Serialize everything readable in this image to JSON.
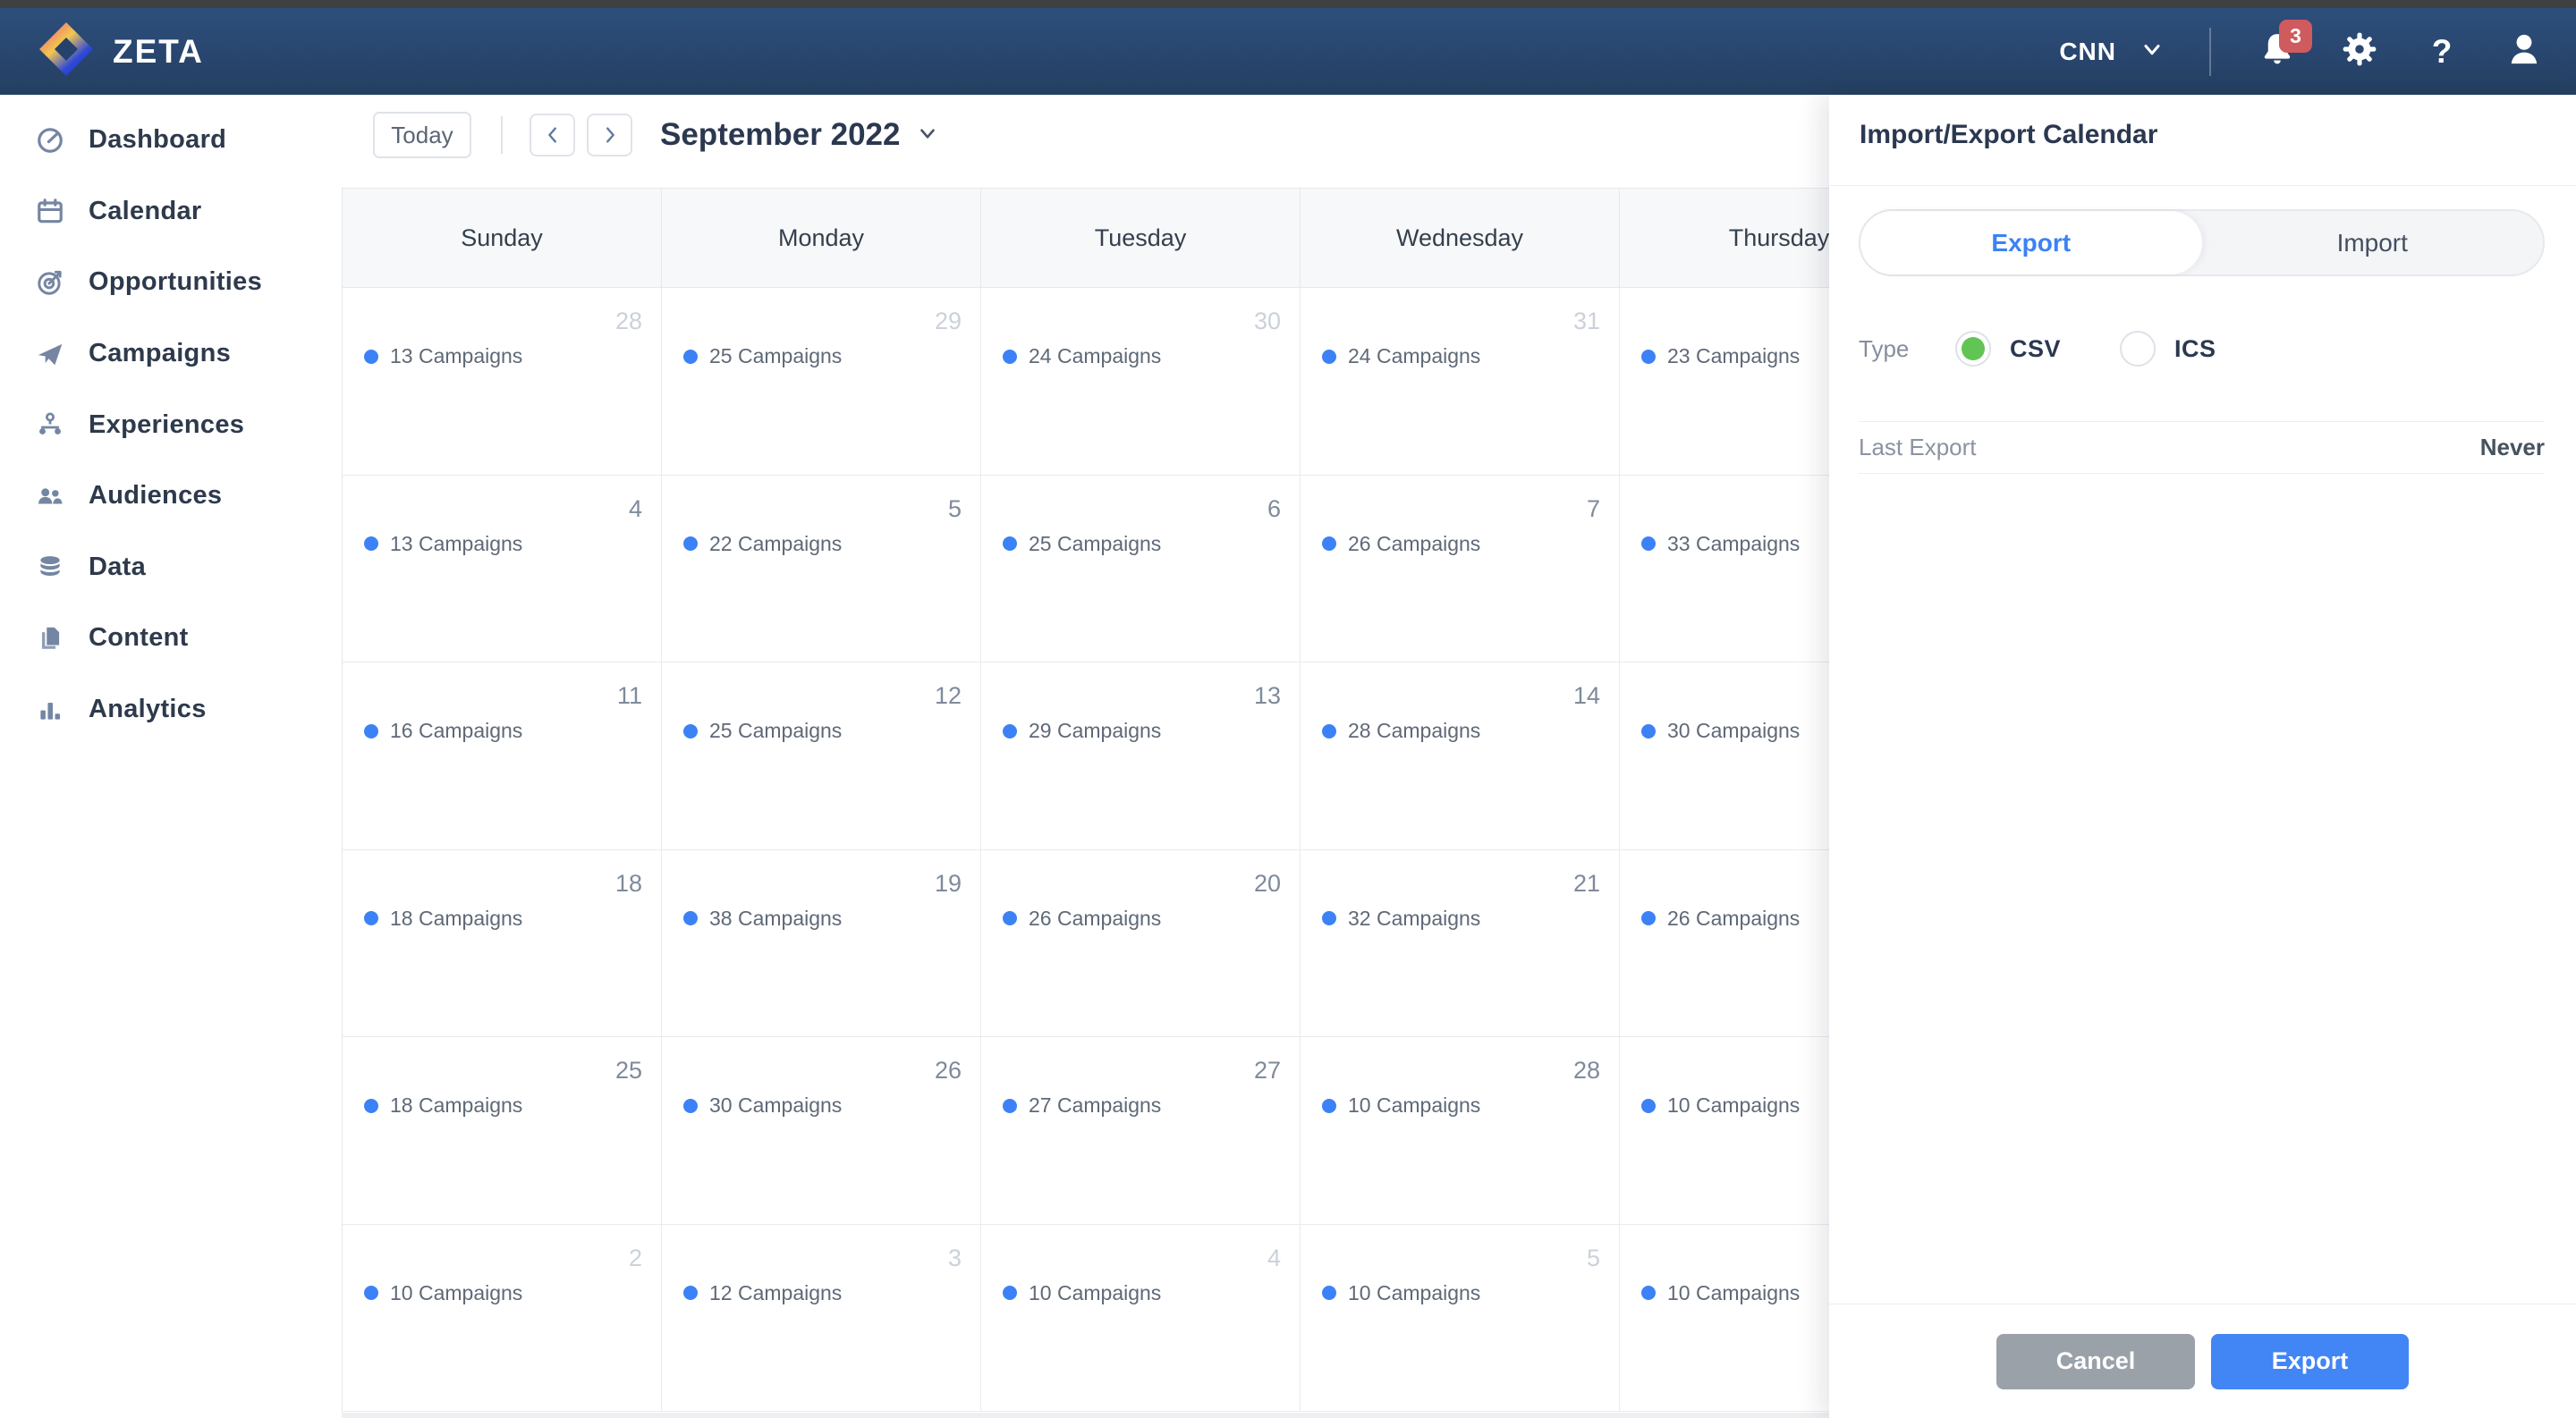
{
  "navbar": {
    "brand": "ZETA",
    "account": "CNN",
    "notification_count": "3",
    "help_glyph": "?"
  },
  "sidebar": {
    "items": [
      {
        "label": "Dashboard",
        "icon": "dashboard-icon"
      },
      {
        "label": "Calendar",
        "icon": "calendar-icon"
      },
      {
        "label": "Opportunities",
        "icon": "opportunities-icon"
      },
      {
        "label": "Campaigns",
        "icon": "campaigns-icon"
      },
      {
        "label": "Experiences",
        "icon": "experiences-icon"
      },
      {
        "label": "Audiences",
        "icon": "audiences-icon"
      },
      {
        "label": "Data",
        "icon": "data-icon"
      },
      {
        "label": "Content",
        "icon": "content-icon"
      },
      {
        "label": "Analytics",
        "icon": "analytics-icon"
      }
    ]
  },
  "toolbar": {
    "today_label": "Today",
    "month_label": "September 2022"
  },
  "calendar": {
    "day_headers": [
      "Sunday",
      "Monday",
      "Tuesday",
      "Wednesday",
      "Thursday"
    ],
    "weeks": [
      {
        "cells": [
          {
            "date": "28",
            "other_month": true,
            "event": "13 Campaigns"
          },
          {
            "date": "29",
            "other_month": true,
            "event": "25 Campaigns"
          },
          {
            "date": "30",
            "other_month": true,
            "event": "24 Campaigns"
          },
          {
            "date": "31",
            "other_month": true,
            "event": "24 Campaigns"
          },
          {
            "date": "",
            "other_month": false,
            "event": "23 Campaigns"
          }
        ]
      },
      {
        "cells": [
          {
            "date": "4",
            "other_month": false,
            "event": "13 Campaigns"
          },
          {
            "date": "5",
            "other_month": false,
            "event": "22 Campaigns"
          },
          {
            "date": "6",
            "other_month": false,
            "event": "25 Campaigns"
          },
          {
            "date": "7",
            "other_month": false,
            "event": "26 Campaigns"
          },
          {
            "date": "",
            "other_month": false,
            "event": "33 Campaigns"
          }
        ]
      },
      {
        "cells": [
          {
            "date": "11",
            "other_month": false,
            "event": "16 Campaigns"
          },
          {
            "date": "12",
            "other_month": false,
            "event": "25 Campaigns"
          },
          {
            "date": "13",
            "other_month": false,
            "event": "29 Campaigns"
          },
          {
            "date": "14",
            "other_month": false,
            "event": "28 Campaigns"
          },
          {
            "date": "",
            "other_month": false,
            "event": "30 Campaigns"
          }
        ]
      },
      {
        "cells": [
          {
            "date": "18",
            "other_month": false,
            "event": "18 Campaigns"
          },
          {
            "date": "19",
            "other_month": false,
            "event": "38 Campaigns"
          },
          {
            "date": "20",
            "other_month": false,
            "event": "26 Campaigns"
          },
          {
            "date": "21",
            "other_month": false,
            "event": "32 Campaigns"
          },
          {
            "date": "",
            "other_month": false,
            "event": "26 Campaigns"
          }
        ]
      },
      {
        "cells": [
          {
            "date": "25",
            "other_month": false,
            "event": "18 Campaigns"
          },
          {
            "date": "26",
            "other_month": false,
            "event": "30 Campaigns"
          },
          {
            "date": "27",
            "other_month": false,
            "event": "27 Campaigns"
          },
          {
            "date": "28",
            "other_month": false,
            "event": "10 Campaigns"
          },
          {
            "date": "",
            "other_month": false,
            "event": "10 Campaigns"
          }
        ]
      },
      {
        "cells": [
          {
            "date": "2",
            "other_month": true,
            "event": "10 Campaigns"
          },
          {
            "date": "3",
            "other_month": true,
            "event": "12 Campaigns"
          },
          {
            "date": "4",
            "other_month": true,
            "event": "10 Campaigns"
          },
          {
            "date": "5",
            "other_month": true,
            "event": "10 Campaigns"
          },
          {
            "date": "",
            "other_month": false,
            "event": "10 Campaigns"
          }
        ]
      }
    ]
  },
  "panel": {
    "title": "Import/Export Calendar",
    "tabs": [
      {
        "label": "Export",
        "active": true
      },
      {
        "label": "Import",
        "active": false
      }
    ],
    "type_label": "Type",
    "type_options": [
      {
        "label": "CSV",
        "selected": true
      },
      {
        "label": "ICS",
        "selected": false
      }
    ],
    "last_export_label": "Last Export",
    "last_export_value": "Never",
    "cancel_label": "Cancel",
    "export_label": "Export"
  },
  "colors": {
    "accent_blue": "#3b82f6",
    "event_dot_blue": "#3c82f6",
    "radio_green": "#62c454",
    "badge_red": "#cf5b5e",
    "cancel_gray": "#9aa1a9",
    "export_button_blue": "#4285f4",
    "navbar_blue": "#27436a"
  }
}
